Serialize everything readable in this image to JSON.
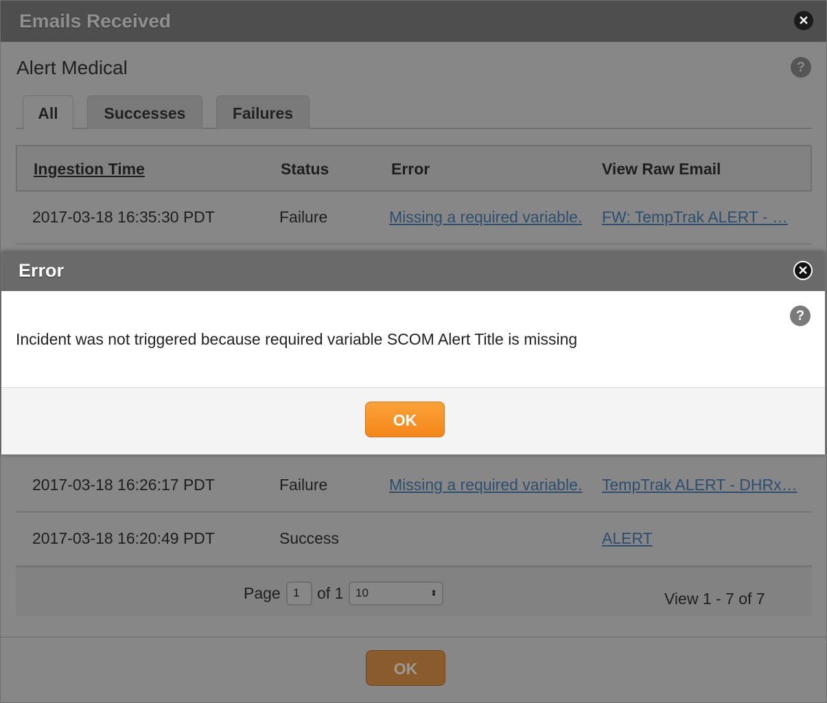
{
  "outer": {
    "title": "Emails Received",
    "subtitle": "Alert Medical",
    "tabs": [
      {
        "label": "All",
        "active": true
      },
      {
        "label": "Successes"
      },
      {
        "label": "Failures"
      }
    ],
    "columns": [
      "Ingestion Time",
      "Status",
      "Error",
      "View Raw Email"
    ],
    "rows": [
      {
        "time": "2017-03-18 16:35:30 PDT",
        "status": "Failure",
        "error": "Missing a required variable.",
        "email": "FW: TempTrak ALERT - …"
      },
      {
        "time": "2017-03-18 16:26:17 PDT",
        "status": "Failure",
        "error": "Missing a required variable.",
        "email": "TempTrak ALERT - DHRx…"
      },
      {
        "time": "2017-03-18 16:20:49 PDT",
        "status": "Success",
        "error": "",
        "email": "ALERT"
      }
    ],
    "pager": {
      "page_label": "Page",
      "page": "1",
      "of_label": "of 1",
      "page_size": "10",
      "view": "View 1 - 7 of 7"
    },
    "ok_label": "OK"
  },
  "error_dialog": {
    "title": "Error",
    "message": "Incident was not triggered because required variable SCOM Alert Title is missing",
    "ok_label": "OK"
  },
  "colors": {
    "accent": "#f7941d"
  }
}
